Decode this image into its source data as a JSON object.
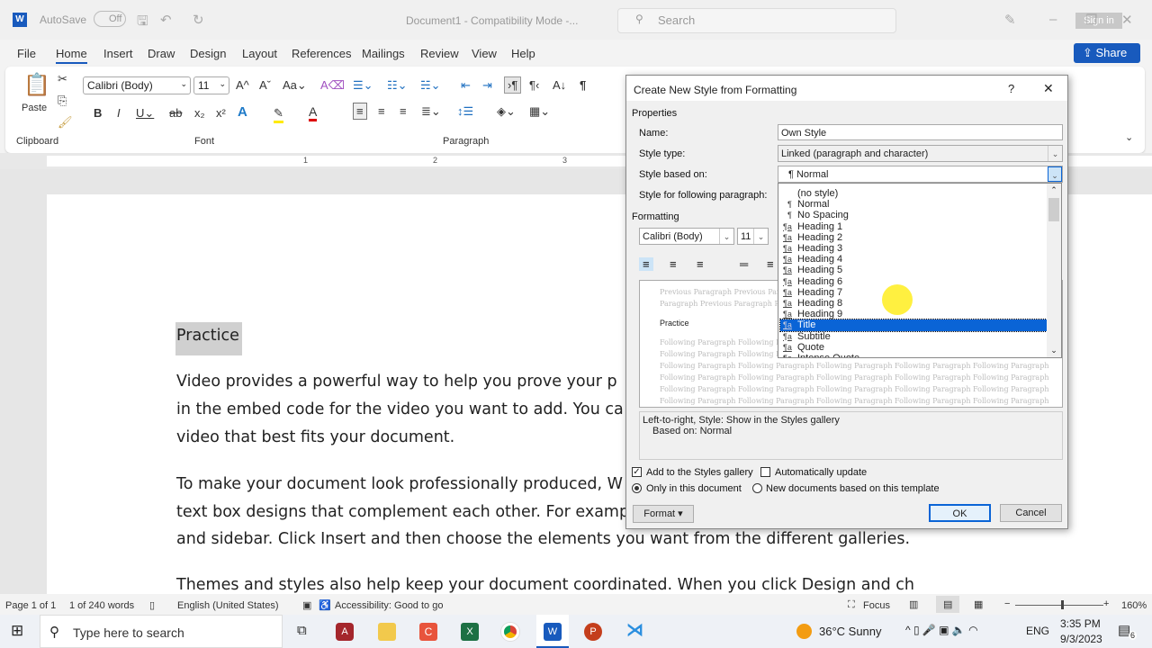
{
  "titlebar": {
    "autosave_label": "AutoSave",
    "autosave_state": "Off",
    "doc_title": "Document1  -  Compatibility Mode  -...",
    "search_placeholder": "Search",
    "signin": "Sign in"
  },
  "tabs": [
    "File",
    "Home",
    "Insert",
    "Draw",
    "Design",
    "Layout",
    "References",
    "Mailings",
    "Review",
    "View",
    "Help"
  ],
  "share": "Share",
  "ribbon": {
    "paste": "Paste",
    "font_name": "Calibri (Body)",
    "font_size": "11",
    "groups": {
      "clipboard": "Clipboard",
      "font": "Font",
      "paragraph": "Paragraph"
    }
  },
  "ruler": {
    "ticks": [
      "1",
      "2",
      "3"
    ]
  },
  "document": {
    "heading": "Practice",
    "lines": [
      "Video provides a powerful way to help you prove your p",
      "in the embed code for the video you want to add. You ca",
      "video that best fits your document.",
      "To make your document look professionally produced, W",
      "text box designs that complement each other. For examp",
      "and sidebar. Click Insert and then choose the elements you want from the different galleries.",
      "Themes and styles also help keep your document coordinated. When you click Design and ch"
    ]
  },
  "dialog": {
    "title": "Create New Style from Formatting",
    "help": "?",
    "properties": "Properties",
    "name_label": "Name:",
    "name_value": "Own Style",
    "type_label": "Style type:",
    "type_value": "Linked (paragraph and character)",
    "based_label": "Style based on:",
    "based_value": "Normal",
    "following_label": "Style for following paragraph:",
    "formatting": "Formatting",
    "font": "Calibri (Body)",
    "size": "11",
    "preview": {
      "prev": "Previous Paragraph Previous Paragraph Previous Paragraph Previous",
      "prev2": "Paragraph Previous Paragraph Previous Paragraph",
      "sample": "Practice",
      "following": "Following Paragraph Following Paragraph Following Paragraph Following Paragraph Following Paragraph"
    },
    "description": [
      "Left-to-right, Style: Show in the Styles gallery",
      "Based on: Normal"
    ],
    "add_gallery": "Add to the Styles gallery",
    "add_gallery_checked": true,
    "auto_update": "Automatically update",
    "auto_update_checked": false,
    "only_doc": "Only in this document",
    "new_docs": "New documents based on this template",
    "format_btn": "Format",
    "ok": "OK",
    "cancel": "Cancel"
  },
  "style_list": {
    "selected": "Title",
    "items": [
      {
        "label": "(no style)",
        "glyph": ""
      },
      {
        "label": "Normal",
        "glyph": "¶"
      },
      {
        "label": "No Spacing",
        "glyph": "¶"
      },
      {
        "label": "Heading 1",
        "glyph": "¶a"
      },
      {
        "label": "Heading 2",
        "glyph": "¶a"
      },
      {
        "label": "Heading 3",
        "glyph": "¶a"
      },
      {
        "label": "Heading 4",
        "glyph": "¶a"
      },
      {
        "label": "Heading 5",
        "glyph": "¶a"
      },
      {
        "label": "Heading 6",
        "glyph": "¶a"
      },
      {
        "label": "Heading 7",
        "glyph": "¶a"
      },
      {
        "label": "Heading 8",
        "glyph": "¶a"
      },
      {
        "label": "Heading 9",
        "glyph": "¶a"
      },
      {
        "label": "Title",
        "glyph": "¶a"
      },
      {
        "label": "Subtitle",
        "glyph": "¶a"
      },
      {
        "label": "Quote",
        "glyph": "¶a"
      },
      {
        "label": "Intense Quote",
        "glyph": "¶a"
      }
    ]
  },
  "status": {
    "page": "Page 1 of 1",
    "words": "1 of 240 words",
    "language": "English (United States)",
    "accessibility": "Accessibility: Good to go",
    "focus": "Focus",
    "zoom": "160%"
  },
  "taskbar": {
    "search": "Type here to search",
    "weather": "36°C  Sunny",
    "lang": "ENG",
    "time": "3:35 PM",
    "date": "9/3/2023",
    "notifications": "6"
  },
  "colors": {
    "accent": "#185abd",
    "selection": "#0a64d6"
  }
}
